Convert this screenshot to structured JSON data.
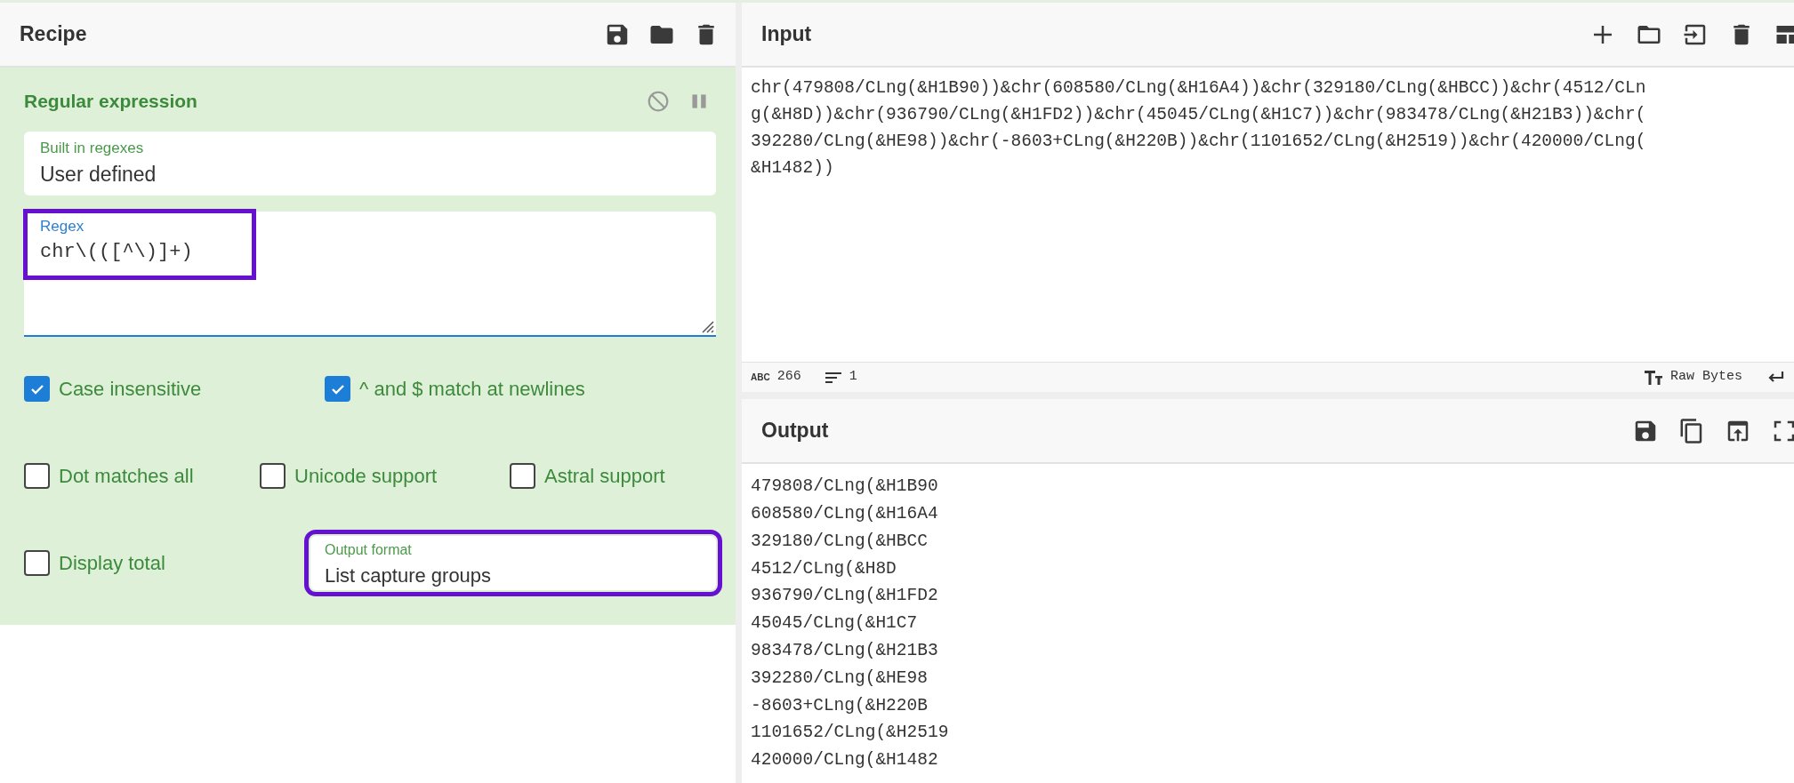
{
  "recipe": {
    "title": "Recipe"
  },
  "operation": {
    "title": "Regular expression",
    "fields": [
      {
        "kind": "select",
        "label": "Built in regexes",
        "value": "User defined",
        "highlighted": false
      },
      {
        "kind": "textarea",
        "label": "Regex",
        "value": "chr\\(([^\\)]+)",
        "highlighted": true
      }
    ],
    "option_rows": [
      [
        {
          "kind": "checkbox",
          "label": "Case insensitive",
          "checked": true
        },
        {
          "kind": "checkbox",
          "label": "^ and $ match at newlines",
          "checked": true
        }
      ],
      [
        {
          "kind": "checkbox",
          "label": "Dot matches all",
          "checked": false
        },
        {
          "kind": "checkbox",
          "label": "Unicode support",
          "checked": false
        },
        {
          "kind": "checkbox",
          "label": "Astral support",
          "checked": false
        }
      ],
      [
        {
          "kind": "checkbox",
          "label": "Display total",
          "checked": false
        },
        {
          "kind": "select",
          "label": "Output format",
          "value": "List capture groups",
          "highlighted": true
        }
      ]
    ]
  },
  "input": {
    "title": "Input",
    "text": "chr(479808/CLng(&H1B90))&chr(608580/CLng(&H16A4))&chr(329180/CLng(&HBCC))&chr(4512/CLng(&H8D))&chr(936790/CLng(&H1FD2))&chr(45045/CLng(&H1C7))&chr(983478/CLng(&H21B3))&chr(392280/CLng(&HE98))&chr(-8603+CLng(&H220B))&chr(1101652/CLng(&H2519))&chr(420000/CLng(&H1482))",
    "status": {
      "length_label": "ABC",
      "length": "266",
      "lines": "1",
      "encoding": "Raw Bytes"
    }
  },
  "output": {
    "title": "Output",
    "lines": [
      "479808/CLng(&H1B90",
      "608580/CLng(&H16A4",
      "329180/CLng(&HBCC",
      "4512/CLng(&H8D",
      "936790/CLng(&H1FD2",
      "45045/CLng(&H1C7",
      "983478/CLng(&H21B3",
      "392280/CLng(&HE98",
      "-8603+CLng(&H220B",
      "1101652/CLng(&H2519",
      "420000/CLng(&H1482"
    ]
  }
}
